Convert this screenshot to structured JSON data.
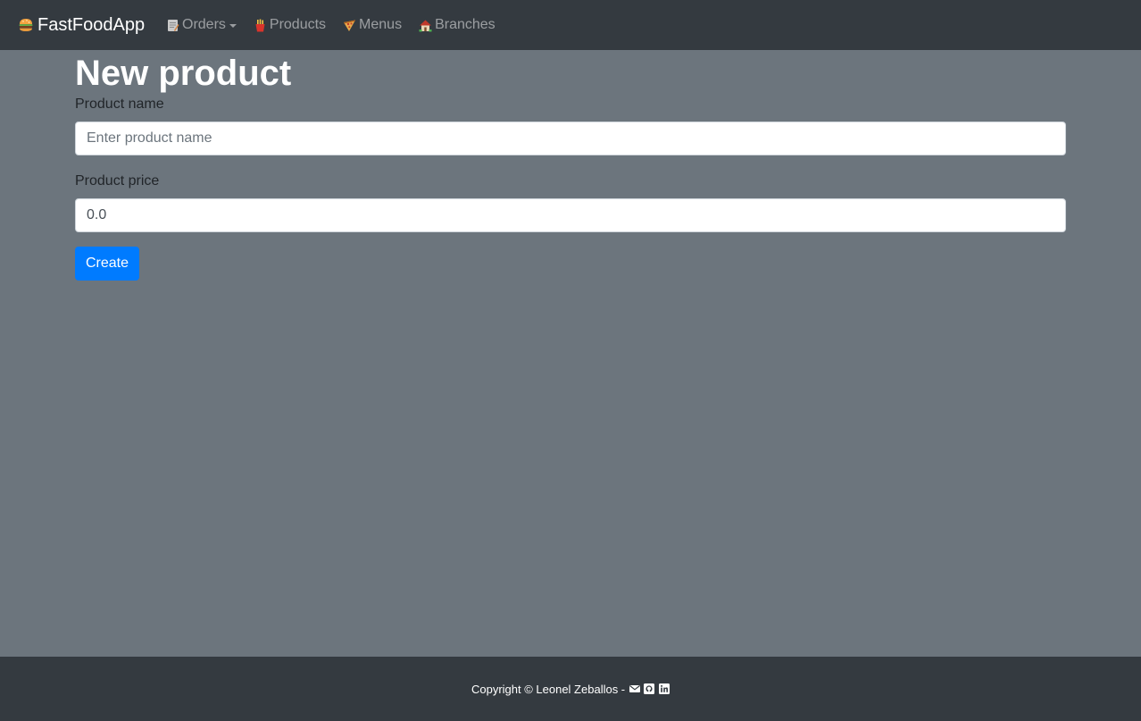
{
  "navbar": {
    "brand": "FastFoodApp",
    "brand_icon": "burger-icon",
    "items": [
      {
        "label": "Orders",
        "icon": "memo-icon",
        "dropdown": true
      },
      {
        "label": "Products",
        "icon": "fries-icon"
      },
      {
        "label": "Menus",
        "icon": "pizza-icon"
      },
      {
        "label": "Branches",
        "icon": "house-icon"
      }
    ]
  },
  "main": {
    "title": "New product",
    "form": {
      "name_label": "Product name",
      "name_placeholder": "Enter product name",
      "name_value": "",
      "price_label": "Product price",
      "price_value": "0.0",
      "submit_label": "Create"
    }
  },
  "footer": {
    "copyright": "Copyright © Leonel Zeballos -",
    "icons": [
      "envelope-icon",
      "github-icon",
      "linkedin-icon"
    ]
  },
  "colors": {
    "navbar_bg": "#343a40",
    "page_bg": "#6c757d",
    "primary": "#007bff"
  }
}
